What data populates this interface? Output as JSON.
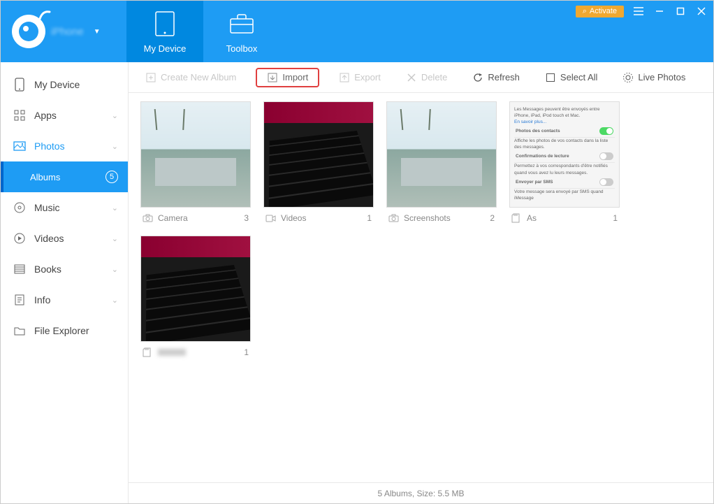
{
  "header": {
    "tabs": [
      {
        "label": "My Device",
        "active": true
      },
      {
        "label": "Toolbox",
        "active": false
      }
    ],
    "activate_label": "Activate"
  },
  "sidebar": {
    "items": [
      {
        "label": "My Device",
        "icon": "device",
        "expandable": false
      },
      {
        "label": "Apps",
        "icon": "apps",
        "expandable": true
      },
      {
        "label": "Photos",
        "icon": "photos",
        "expandable": true,
        "active": true,
        "children": [
          {
            "label": "Albums",
            "count": 5,
            "selected": true
          }
        ]
      },
      {
        "label": "Music",
        "icon": "music",
        "expandable": true
      },
      {
        "label": "Videos",
        "icon": "videos",
        "expandable": true
      },
      {
        "label": "Books",
        "icon": "books",
        "expandable": true
      },
      {
        "label": "Info",
        "icon": "info",
        "expandable": true
      },
      {
        "label": "File Explorer",
        "icon": "folder",
        "expandable": false
      }
    ]
  },
  "toolbar": {
    "create_album": "Create New Album",
    "import": "Import",
    "export": "Export",
    "delete": "Delete",
    "refresh": "Refresh",
    "select_all": "Select All",
    "live_photos": "Live Photos"
  },
  "albums": [
    {
      "name": "Camera",
      "count": 3,
      "icon": "camera",
      "thumb": "beach"
    },
    {
      "name": "Videos",
      "count": 1,
      "icon": "video",
      "thumb": "keyboard"
    },
    {
      "name": "Screenshots",
      "count": 2,
      "icon": "camera",
      "thumb": "beach"
    },
    {
      "name": "As",
      "count": 1,
      "icon": "sd",
      "thumb": "settings"
    },
    {
      "name": "",
      "count": 1,
      "icon": "sd",
      "thumb": "keyboard",
      "blurred": true
    }
  ],
  "settings_thumb": {
    "line1": "Les Messages peuvent être envoyés entre iPhone, iPad, iPod touch et Mac.",
    "link1": "En savoir plus...",
    "row1": "Photos des contacts",
    "sub1": "Affiche les photos de vos contacts dans la liste des messages.",
    "row2": "Confirmations de lecture",
    "sub2": "Permettez à vos correspondants d'être notifiés quand vous avez lu leurs messages.",
    "row3": "Envoyer par SMS",
    "sub3": "Votre message sera envoyé par SMS quand iMessage"
  },
  "statusbar": {
    "text": "5 Albums, Size: 5.5 MB"
  }
}
